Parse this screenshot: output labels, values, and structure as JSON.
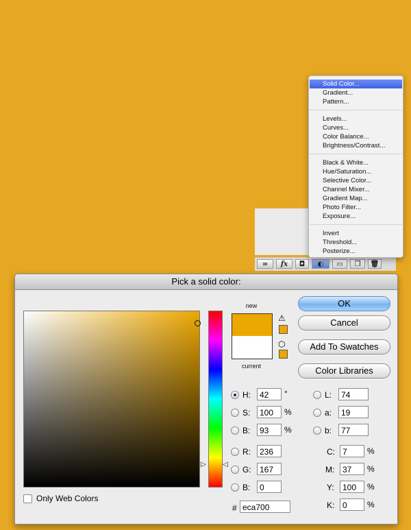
{
  "menu": {
    "items": [
      {
        "label": "Solid Color...",
        "selected": true
      },
      {
        "label": "Gradient..."
      },
      {
        "label": "Pattern..."
      },
      {
        "label": "Levels..."
      },
      {
        "label": "Curves..."
      },
      {
        "label": "Color Balance..."
      },
      {
        "label": "Brightness/Contrast..."
      },
      {
        "label": "Black & White..."
      },
      {
        "label": "Hue/Saturation..."
      },
      {
        "label": "Selective Color..."
      },
      {
        "label": "Channel Mixer..."
      },
      {
        "label": "Gradient Map..."
      },
      {
        "label": "Photo Filter..."
      },
      {
        "label": "Exposure..."
      },
      {
        "label": "Invert"
      },
      {
        "label": "Threshold..."
      },
      {
        "label": "Posterize..."
      }
    ]
  },
  "layers_toolbar": {
    "icons": [
      "link-icon",
      "fx-icon",
      "mask-icon",
      "adjustment-layer-icon",
      "folder-icon",
      "new-layer-icon",
      "trash-icon"
    ],
    "fx_label": "fx"
  },
  "dialog": {
    "title": "Pick a solid color:",
    "new_label": "new",
    "current_label": "current",
    "new_color": "#eca700",
    "current_color": "#ffffff",
    "buttons": {
      "ok": "OK",
      "cancel": "Cancel",
      "add_swatches": "Add To Swatches",
      "color_libraries": "Color Libraries"
    },
    "hsb": {
      "h_label": "H:",
      "h_value": "42",
      "h_unit": "°",
      "s_label": "S:",
      "s_value": "100",
      "s_unit": "%",
      "b_label": "B:",
      "b_value": "93",
      "b_unit": "%"
    },
    "rgb": {
      "r_label": "R:",
      "r_value": "236",
      "g_label": "G:",
      "g_value": "167",
      "b_label": "B:",
      "b_value": "0"
    },
    "lab": {
      "l_label": "L:",
      "l_value": "74",
      "a_label": "a:",
      "a_value": "19",
      "b_label": "b:",
      "b_value": "77"
    },
    "cmyk": {
      "c_label": "C:",
      "c_value": "7",
      "m_label": "M:",
      "m_value": "37",
      "y_label": "Y:",
      "y_value": "100",
      "k_label": "K:",
      "k_value": "0",
      "unit": "%"
    },
    "hex_label": "#",
    "hex_value": "eca700",
    "only_web_colors": "Only Web Colors",
    "selected_mode": "H"
  },
  "colors": {
    "background": "#e6a723",
    "accent": "#eca700",
    "menu_selected": "#3f63e4"
  }
}
